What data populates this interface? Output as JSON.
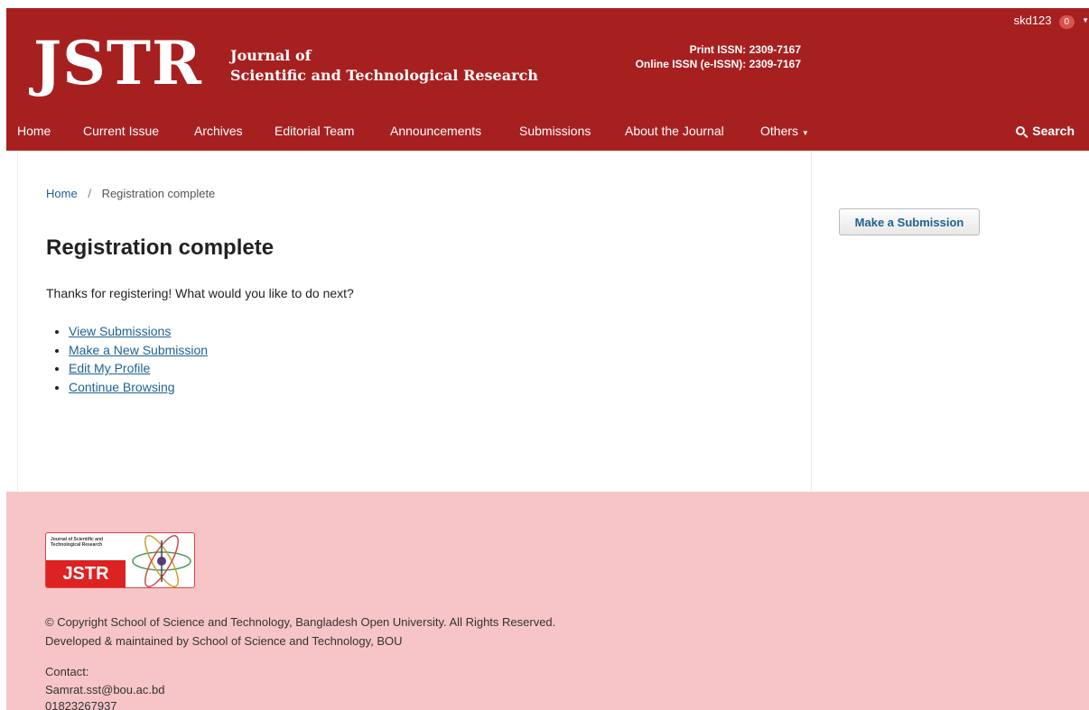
{
  "header": {
    "logo_text": "JSTR",
    "journal_line1": "Journal of",
    "journal_line2": "Scientific and Technological Research",
    "print_issn": "Print ISSN: 2309-7167",
    "online_issn": "Online ISSN (e-ISSN): 2309-7167",
    "username": "skd123",
    "notification_count": "0"
  },
  "nav": {
    "items": [
      "Home",
      "Current Issue",
      "Archives",
      "Editorial Team",
      "Announcements",
      "Submissions",
      "About the Journal",
      "Others"
    ],
    "search_label": "Search"
  },
  "breadcrumb": {
    "home": "Home",
    "separator": "/",
    "current": "Registration complete"
  },
  "main": {
    "title": "Registration complete",
    "intro": "Thanks for registering! What would you like to do next?",
    "links": [
      "View Submissions",
      "Make a New Submission",
      "Edit My Profile",
      "Continue Browsing"
    ]
  },
  "sidebar": {
    "submit_label": "Make a Submission"
  },
  "footer": {
    "logo_small_text": "Journal of Scientific and Technological Research",
    "logo_text": "JSTR",
    "copyright": "© Copyright School of Science and Technology, Bangladesh Open University. All Rights Reserved.",
    "developed": "Developed & maintained by School of Science and Technology, BOU",
    "contact_label": "Contact:",
    "email": "Samrat.sst@bou.ac.bd",
    "phone": "01823267937"
  },
  "colors": {
    "header_bg": "#a72020",
    "footer_bg": "#f7c5c7",
    "link": "#1e6292"
  }
}
